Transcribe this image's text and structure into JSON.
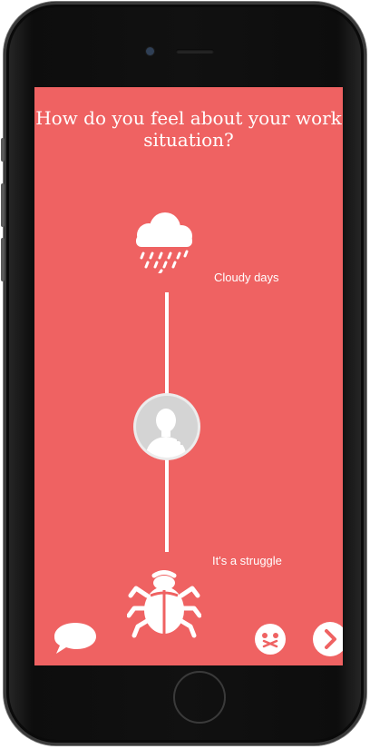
{
  "question": {
    "text": "How do you feel about your work situation?"
  },
  "slider": {
    "top_label": "Cloudy days",
    "bottom_label": "It's a struggle",
    "top_icon": "rain-cloud-icon",
    "bottom_icon": "bug-icon",
    "handle_icon": "add-person-icon"
  },
  "footer": {
    "left_icon": "chat-bubble-icon",
    "sad_icon": "sad-face-icon",
    "next_icon": "chevron-right-icon"
  },
  "colors": {
    "background": "#ef6262",
    "foreground": "#ffffff",
    "handle": "#d4d4d4"
  }
}
